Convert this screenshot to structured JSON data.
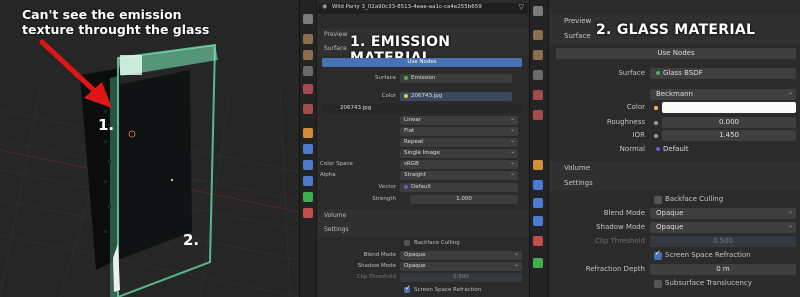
{
  "viewport": {
    "annotation": "Can't see the emission texture throught the glass",
    "marker_1": "1.",
    "marker_2": "2."
  },
  "emission": {
    "heading": "1. EMISSION MATERIAL",
    "material_name": "Wild Party 3_02a90c33-8513-4eae-aa1c-ca4e255b659",
    "preview": "Preview",
    "surface_section": "Surface",
    "use_nodes": "Use Nodes",
    "surface_label": "Surface",
    "surface_value": "Emission",
    "color_label": "Color",
    "color_value": "206743.jpg",
    "image_name": "206743.jpg",
    "interp": "Linear",
    "projection": "Flat",
    "extension": "Repeat",
    "source": "Single Image",
    "colorspace_label": "Color Space",
    "colorspace_value": "sRGB",
    "alpha_label": "Alpha",
    "alpha_value": "Straight",
    "vector_label": "Vector",
    "vector_value": "Default",
    "strength_label": "Strength",
    "strength_value": "1.000",
    "volume": "Volume",
    "settings": "Settings",
    "backface": "Backface Culling",
    "blend_label": "Blend Mode",
    "blend_value": "Opaque",
    "shadow_label": "Shadow Mode",
    "shadow_value": "Opaque",
    "clip_label": "Clip Threshold",
    "clip_value": "0.500",
    "ssr": "Screen Space Refraction"
  },
  "glass": {
    "heading": "2. GLASS MATERIAL",
    "preview": "Preview",
    "surface_section": "Surface",
    "use_nodes": "Use Nodes",
    "surface_label": "Surface",
    "surface_value": "Glass BSDF",
    "distribution": "Beckmann",
    "color_label": "Color",
    "roughness_label": "Roughness",
    "roughness_value": "0.000",
    "ior_label": "IOR",
    "ior_value": "1.450",
    "normal_label": "Normal",
    "normal_value": "Default",
    "volume": "Volume",
    "settings": "Settings",
    "backface": "Backface Culling",
    "blend_label": "Blend Mode",
    "blend_value": "Opaque",
    "shadow_label": "Shadow Mode",
    "shadow_value": "Opaque",
    "clip_label": "Clip Threshold",
    "clip_value": "0.500",
    "ssr": "Screen Space Refraction",
    "refr_depth_label": "Refraction Depth",
    "refr_depth_value": "0 m",
    "subsurface": "Subsurface Translucency"
  },
  "colors": {
    "accent_blue": "#4772b3",
    "glass_green": "#6fe6b0",
    "arrow_red": "#e01616"
  }
}
